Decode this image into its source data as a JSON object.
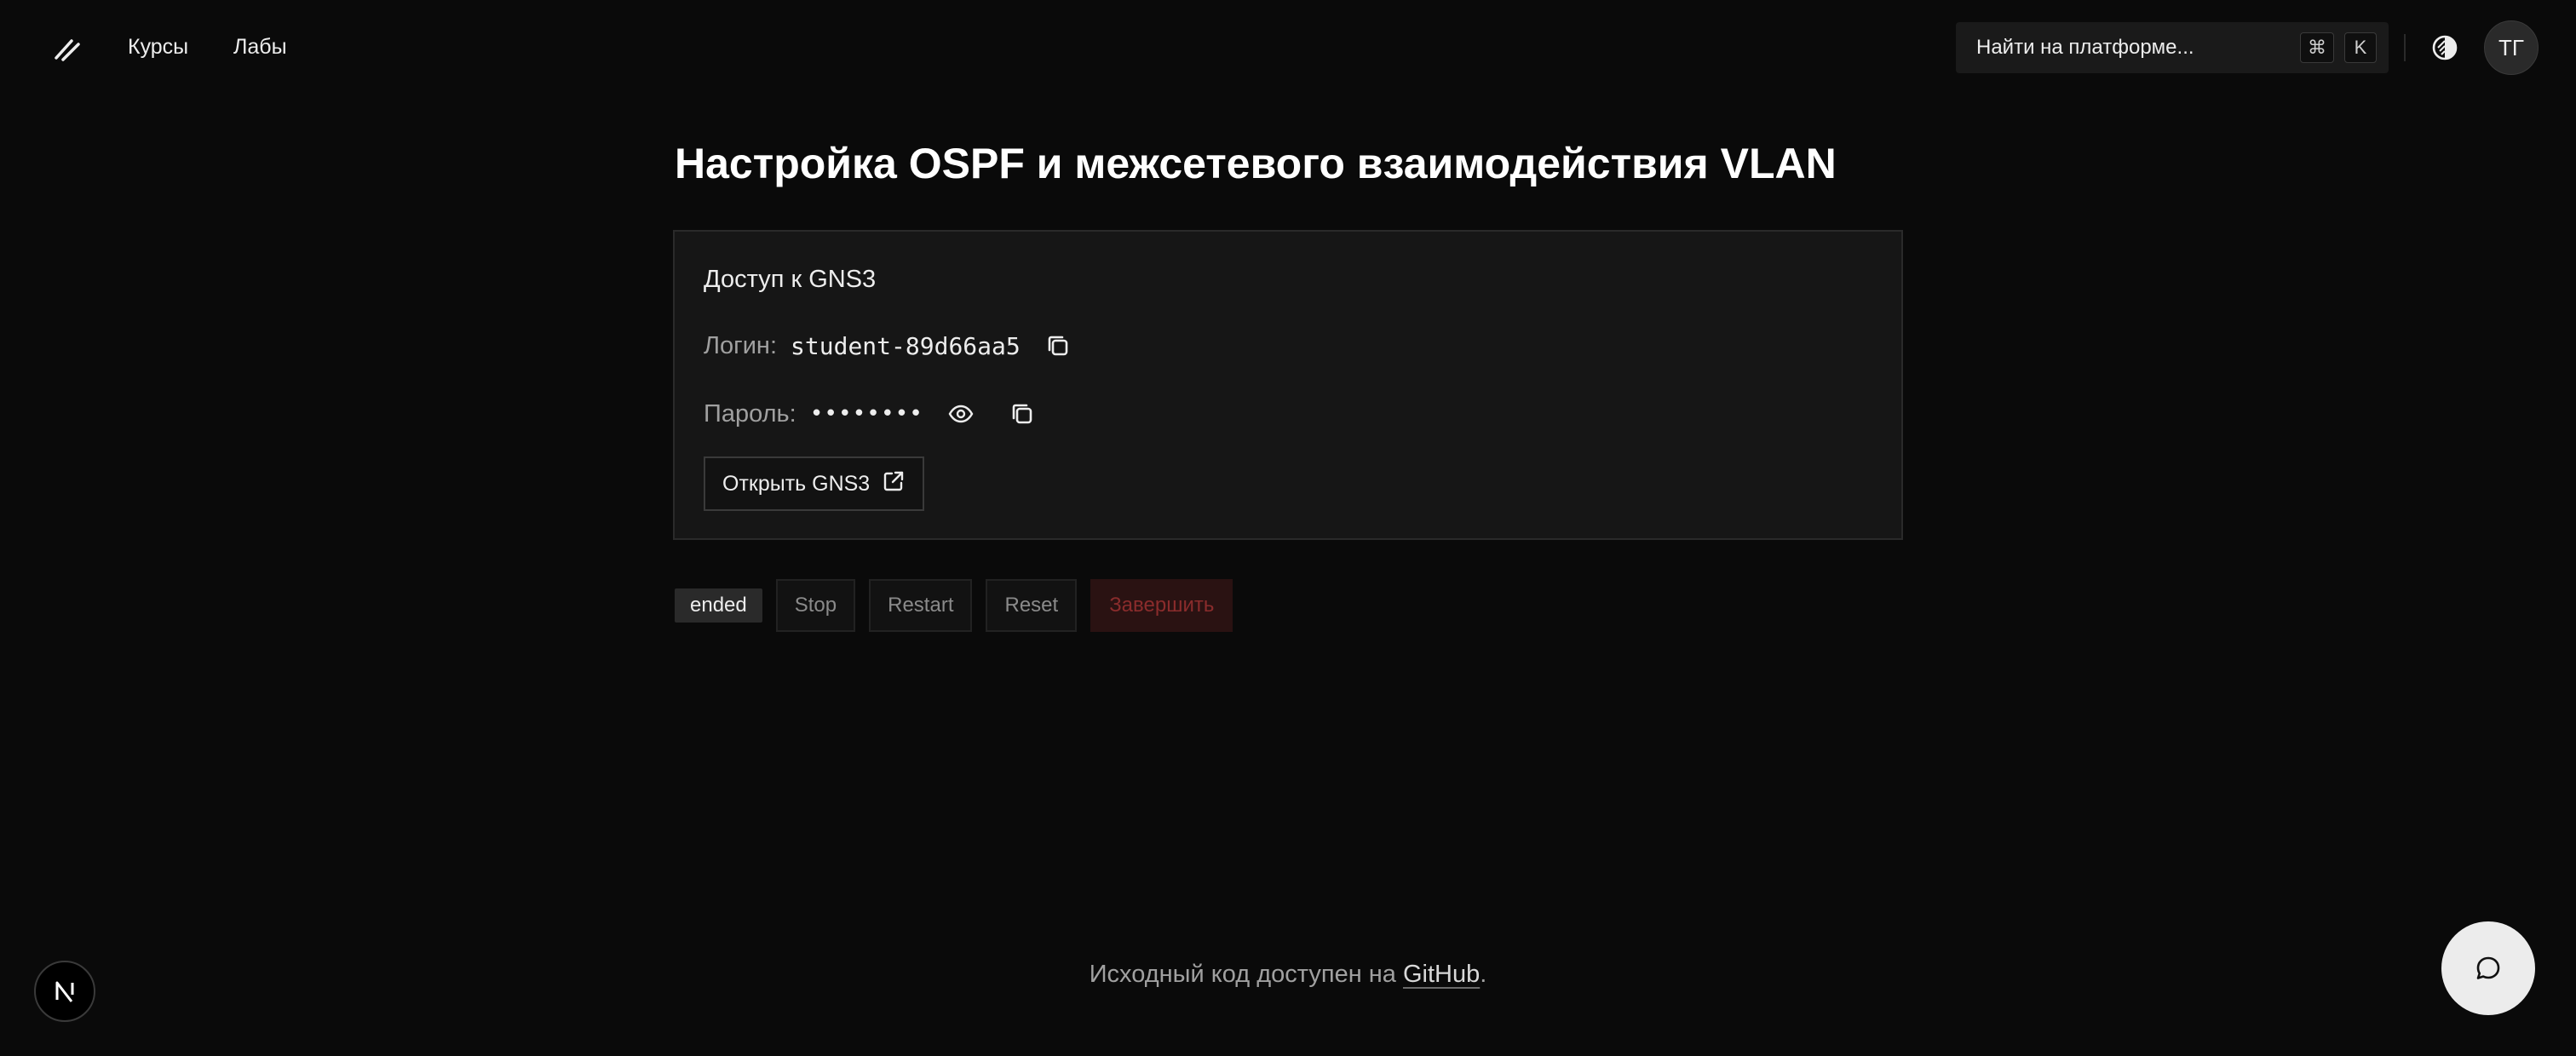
{
  "header": {
    "logo_icon": "slash-logo-icon",
    "nav": [
      {
        "label": "Курсы"
      },
      {
        "label": "Лабы"
      }
    ],
    "search": {
      "placeholder": "Найти на платформе...",
      "shortcut_keys": [
        "⌘",
        "K"
      ]
    },
    "theme_toggle_icon": "contrast-icon",
    "avatar_initials": "ТГ"
  },
  "main": {
    "title": "Настройка OSPF и межсетевого взаимодействия VLAN",
    "access_card": {
      "title": "Доступ к GNS3",
      "login_label": "Логин:",
      "login_value": "student-89d66aa5",
      "password_label": "Пароль:",
      "password_masked": "••••••••",
      "open_button_label": "Открыть GNS3"
    },
    "controls": {
      "status": "ended",
      "stop_label": "Stop",
      "restart_label": "Restart",
      "reset_label": "Reset",
      "finish_label": "Завершить"
    }
  },
  "footer": {
    "text_prefix": "Исходный код доступен на ",
    "link_label": "GitHub",
    "text_suffix": "."
  },
  "floating": {
    "n_badge_letter": "N",
    "chat_icon": "chat-bubble-icon"
  },
  "colors": {
    "background": "#0a0a0a",
    "card": "#161616",
    "text": "#ededed",
    "muted": "#a0a0a0",
    "danger_text": "#8a2c2c",
    "danger_bg": "#2a1212"
  }
}
